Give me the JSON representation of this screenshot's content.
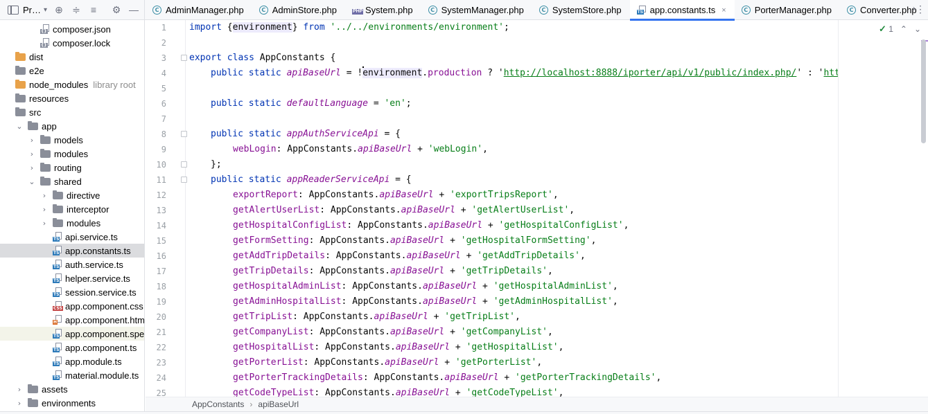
{
  "project_panel": {
    "title": "Pr…",
    "tree": [
      {
        "label": "composer.json",
        "kind": "file",
        "ext": "json",
        "indent": 2
      },
      {
        "label": "composer.lock",
        "kind": "file",
        "ext": "json",
        "indent": 2
      },
      {
        "label": "dist",
        "kind": "folder",
        "color": "orange",
        "indent": 0
      },
      {
        "label": "e2e",
        "kind": "folder",
        "indent": 0
      },
      {
        "label": "node_modules",
        "kind": "folder",
        "color": "orange",
        "indent": 0,
        "note": "library root"
      },
      {
        "label": "resources",
        "kind": "folder",
        "indent": 0
      },
      {
        "label": "src",
        "kind": "folder",
        "indent": 0
      },
      {
        "label": "app",
        "kind": "folder",
        "indent": 1,
        "expanded": true
      },
      {
        "label": "models",
        "kind": "folder",
        "indent": 2,
        "collapsed": true
      },
      {
        "label": "modules",
        "kind": "folder",
        "indent": 2,
        "collapsed": true
      },
      {
        "label": "routing",
        "kind": "folder",
        "indent": 2,
        "collapsed": true
      },
      {
        "label": "shared",
        "kind": "folder",
        "indent": 2,
        "expanded": true
      },
      {
        "label": "directive",
        "kind": "folder",
        "indent": 3,
        "collapsed": true
      },
      {
        "label": "interceptor",
        "kind": "folder",
        "indent": 3,
        "collapsed": true
      },
      {
        "label": "modules",
        "kind": "folder",
        "indent": 3,
        "collapsed": true
      },
      {
        "label": "api.service.ts",
        "kind": "file",
        "ext": "ts",
        "indent": 4
      },
      {
        "label": "app.constants.ts",
        "kind": "file",
        "ext": "ts",
        "indent": 4,
        "selected": true
      },
      {
        "label": "auth.service.ts",
        "kind": "file",
        "ext": "ts",
        "indent": 4
      },
      {
        "label": "helper.service.ts",
        "kind": "file",
        "ext": "ts",
        "indent": 4
      },
      {
        "label": "session.service.ts",
        "kind": "file",
        "ext": "ts",
        "indent": 4
      },
      {
        "label": "app.component.css",
        "kind": "file",
        "ext": "css",
        "indent": 3
      },
      {
        "label": "app.component.html",
        "kind": "file",
        "ext": "html",
        "indent": 3
      },
      {
        "label": "app.component.spec.ts",
        "kind": "file",
        "ext": "ts",
        "indent": 3,
        "highlight": true
      },
      {
        "label": "app.component.ts",
        "kind": "file",
        "ext": "ts",
        "indent": 3
      },
      {
        "label": "app.module.ts",
        "kind": "file",
        "ext": "ts",
        "indent": 3
      },
      {
        "label": "material.module.ts",
        "kind": "file",
        "ext": "ts",
        "indent": 3
      },
      {
        "label": "assets",
        "kind": "folder",
        "indent": 1,
        "collapsed": true
      },
      {
        "label": "environments",
        "kind": "folder",
        "indent": 1,
        "collapsed": true
      }
    ]
  },
  "tabs": [
    {
      "label": "AdminManager.php",
      "icon": "class"
    },
    {
      "label": "AdminStore.php",
      "icon": "class"
    },
    {
      "label": "System.php",
      "icon": "php"
    },
    {
      "label": "SystemManager.php",
      "icon": "class"
    },
    {
      "label": "SystemStore.php",
      "icon": "class"
    },
    {
      "label": "app.constants.ts",
      "icon": "ts",
      "active": true
    },
    {
      "label": "PorterManager.php",
      "icon": "class"
    },
    {
      "label": "Converter.php",
      "icon": "class"
    }
  ],
  "tab_close_glyph": "×",
  "editor": {
    "line_numbers": [
      "1",
      "2",
      "3",
      "4",
      "5",
      "6",
      "7",
      "8",
      "9",
      "10",
      "11",
      "12",
      "13",
      "14",
      "15",
      "16",
      "17",
      "18",
      "19",
      "20",
      "21",
      "22",
      "23",
      "24",
      "25"
    ],
    "code": {
      "l1": [
        "import",
        " {",
        "environment",
        "} ",
        "from",
        " ",
        "'../../environments/environment'",
        ";"
      ],
      "l3": [
        "export",
        " ",
        "class",
        " AppConstants {"
      ],
      "l4": [
        "public",
        " ",
        "static",
        " ",
        "apiBaseUrl",
        " = !",
        "environment",
        ".",
        "production",
        " ? '",
        "http://localhost:8888/iporter/api/v1/public/index.php/",
        "' : '",
        "https://www.iporter.",
        ""
      ],
      "l6": [
        "public",
        " ",
        "static",
        " ",
        "defaultLanguage",
        " = ",
        "'en'",
        ";"
      ],
      "l8": [
        "public",
        " ",
        "static",
        " ",
        "appAuthServiceApi",
        " = {"
      ],
      "l9": [
        "webLogin",
        ": AppConstants.",
        "apiBaseUrl",
        " + ",
        "'webLogin'",
        ","
      ],
      "l10": "};",
      "l11": [
        "public",
        " ",
        "static",
        " ",
        "appReaderServiceApi",
        " = {"
      ],
      "entries": [
        {
          "key": "exportReport",
          "value": "'exportTripsReport'"
        },
        {
          "key": "getAlertUserList",
          "value": "'getAlertUserList'"
        },
        {
          "key": "getHospitalConfigList",
          "value": "'getHospitalConfigList'"
        },
        {
          "key": "getFormSetting",
          "value": "'getHospitalFormSetting'"
        },
        {
          "key": "getAddTripDetails",
          "value": "'getAddTripDetails'"
        },
        {
          "key": "getTripDetails",
          "value": "'getTripDetails'"
        },
        {
          "key": "getHospitalAdminList",
          "value": "'getHospitalAdminList'"
        },
        {
          "key": "getAdminHospitalList",
          "value": "'getAdminHospitalList'"
        },
        {
          "key": "getTripList",
          "value": "'getTripList'"
        },
        {
          "key": "getCompanyList",
          "value": "'getCompanyList'"
        },
        {
          "key": "getHospitalList",
          "value": "'getHospitalList'"
        },
        {
          "key": "getPorterList",
          "value": "'getPorterList'"
        },
        {
          "key": "getPorterTrackingDetails",
          "value": "'getPorterTrackingDetails'"
        },
        {
          "key": "getCodeTypeList",
          "value": "'getCodeTypeList'"
        }
      ],
      "entry_mid": ": AppConstants.",
      "entry_prop": "apiBaseUrl",
      "entry_plus": " + ",
      "entry_end": ","
    }
  },
  "inspection": {
    "count": "1"
  },
  "breadcrumbs": [
    "AppConstants",
    "apiBaseUrl"
  ],
  "colors": {
    "accent": "#3574f0",
    "keyword": "#0033b3",
    "string": "#067d17",
    "property": "#871094"
  }
}
